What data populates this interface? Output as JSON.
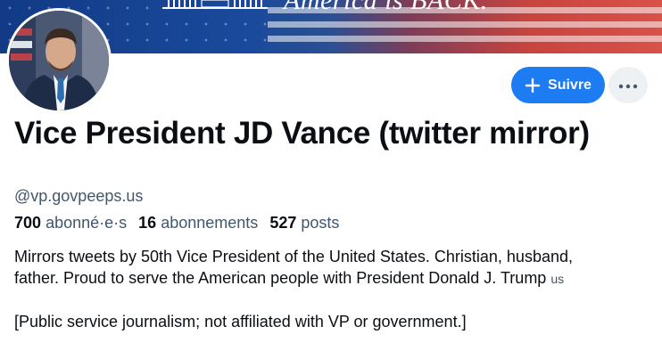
{
  "banner": {
    "slogan": "America is BACK."
  },
  "profile": {
    "display_name": "Vice President JD Vance (twitter mirror)",
    "handle": "@vp.govpeeps.us",
    "stats": {
      "followers_count": "700",
      "followers_label": "abonné·e·s",
      "following_count": "16",
      "following_label": "abonnements",
      "posts_count": "527",
      "posts_label": "posts"
    },
    "bio": {
      "line1": "Mirrors tweets by 50th Vice President of the United States. Christian, husband,",
      "line2": "father. Proud to serve the American people with President Donald J. Trump",
      "line2_flag": "us",
      "line3": "[Public service journalism; not affiliated with VP or government.]"
    }
  },
  "actions": {
    "follow_label": "Suivre",
    "more_icon": "ellipsis-icon",
    "follow_icon": "plus-icon"
  },
  "colors": {
    "accent": "#1d7cf2",
    "text_primary": "#0b0f14",
    "text_secondary": "#42576c",
    "more_button_bg": "#eef1f4"
  }
}
